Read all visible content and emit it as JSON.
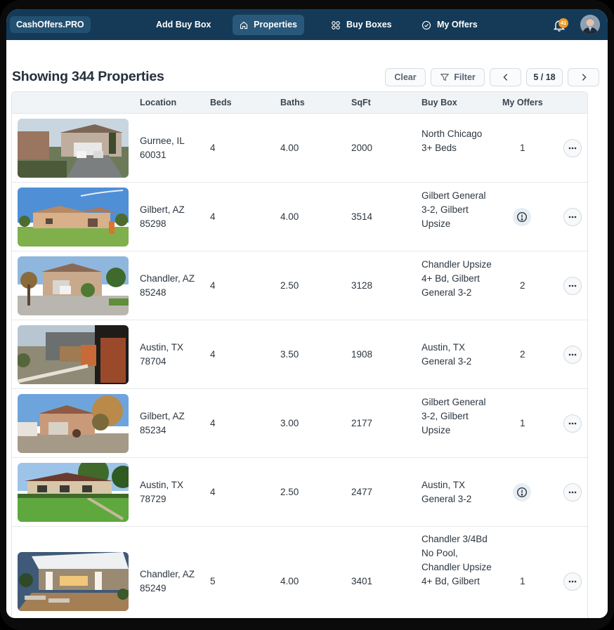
{
  "nav": {
    "brand": "CashOffers.PRO",
    "links": [
      {
        "label": "Add Buy Box"
      },
      {
        "label": "Properties"
      },
      {
        "label": "Buy Boxes"
      },
      {
        "label": "My Offers"
      }
    ],
    "notifications_count": "41"
  },
  "page": {
    "title": "Showing 344 Properties"
  },
  "toolbar": {
    "clear_label": "Clear",
    "filter_label": "Filter",
    "page_indicator": "5 / 18"
  },
  "table": {
    "columns": [
      "Location",
      "Beds",
      "Baths",
      "SqFt",
      "Buy Box",
      "My Offers"
    ],
    "rows": [
      {
        "location": "Gurnee, IL 60031",
        "beds": "4",
        "baths": "4.00",
        "sqft": "2000",
        "buybox": "North Chicago 3+ Beds",
        "offers": "1"
      },
      {
        "location": "Gilbert, AZ 85298",
        "beds": "4",
        "baths": "4.00",
        "sqft": "3514",
        "buybox": "Gilbert General 3-2, Gilbert Upsize",
        "offers": ""
      },
      {
        "location": "Chandler, AZ 85248",
        "beds": "4",
        "baths": "2.50",
        "sqft": "3128",
        "buybox": "Chandler Upsize 4+ Bd, Gilbert General 3-2",
        "offers": "2"
      },
      {
        "location": "Austin, TX 78704",
        "beds": "4",
        "baths": "3.50",
        "sqft": "1908",
        "buybox": "Austin, TX General 3-2",
        "offers": "2"
      },
      {
        "location": "Gilbert, AZ 85234",
        "beds": "4",
        "baths": "3.00",
        "sqft": "2177",
        "buybox": "Gilbert General 3-2, Gilbert Upsize",
        "offers": "1"
      },
      {
        "location": "Austin, TX 78729",
        "beds": "4",
        "baths": "2.50",
        "sqft": "2477",
        "buybox": "Austin, TX General 3-2",
        "offers": ""
      },
      {
        "location": "Chandler, AZ 85249",
        "beds": "5",
        "baths": "4.00",
        "sqft": "3401",
        "buybox": "Chandler 3/4Bd No Pool, Chandler Upsize 4+ Bd, Gilbert",
        "offers": "1"
      }
    ]
  }
}
